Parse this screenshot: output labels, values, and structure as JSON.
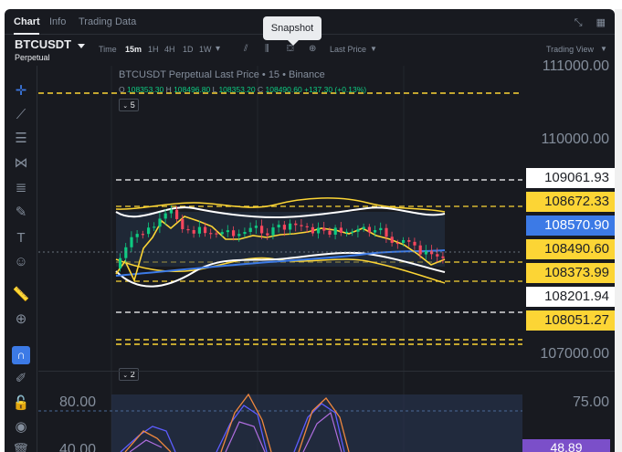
{
  "tabs": [
    "Chart",
    "Info",
    "Trading Data"
  ],
  "window_icons": [
    "expand-icon",
    "grid-icon"
  ],
  "symbol": {
    "name": "BTCUSDT",
    "type": "Perpetual"
  },
  "timeframes": {
    "label": "Time",
    "items": [
      "15m",
      "1H",
      "4H",
      "1D",
      "1W"
    ],
    "active": "15m"
  },
  "toolbar_right": {
    "price_type": "Last Price",
    "view": "Trading View"
  },
  "tooltip": "Snapshot",
  "legend": {
    "title": "BTCUSDT Perpetual Last Price • 15 • Binance",
    "open_label": "O",
    "open": "108353.30",
    "high_label": "H",
    "high": "108496.80",
    "low_label": "L",
    "low": "108353.20",
    "close_label": "C",
    "close": "108490.60",
    "change": "+137.30 (+0.13%)"
  },
  "indicator_badges": {
    "main": "5",
    "sub": "2"
  },
  "price_axis": {
    "labels": [
      "111000.00",
      "110000.00",
      "107000.00"
    ],
    "boxes": [
      {
        "value": "109061.93",
        "bg": "#ffffff",
        "fg": "#1e2026"
      },
      {
        "value": "108672.33",
        "bg": "#fcd535",
        "fg": "#1e2026"
      },
      {
        "value": "108570.90",
        "bg": "#3c7ae6",
        "fg": "#ffffff"
      },
      {
        "value": "108490.60",
        "bg": "#fcd535",
        "fg": "#1e2026"
      },
      {
        "value": "108373.99",
        "bg": "#fcd535",
        "fg": "#1e2026"
      },
      {
        "value": "108201.94",
        "bg": "#ffffff",
        "fg": "#1e2026"
      },
      {
        "value": "108051.27",
        "bg": "#fcd535",
        "fg": "#1e2026"
      }
    ]
  },
  "oscillator": {
    "left_labels": [
      "80.00",
      "40.00"
    ],
    "right_label": "75.00",
    "current": "48.89"
  },
  "tools": [
    "crosshair-icon",
    "trendline-icon",
    "horizontal-lines-icon",
    "pattern-icon",
    "fib-icon",
    "brush-icon",
    "text-icon",
    "emoji-icon",
    "ruler-icon",
    "zoom-icon",
    "magnet-icon",
    "pencil-lock-icon",
    "lock-icon",
    "eye-icon",
    "trash-icon"
  ],
  "colors": {
    "up": "#0ecb81",
    "down": "#f6465d",
    "band": "#f0e040",
    "ma": "#3c7ae6",
    "accent": "#fcd535"
  }
}
